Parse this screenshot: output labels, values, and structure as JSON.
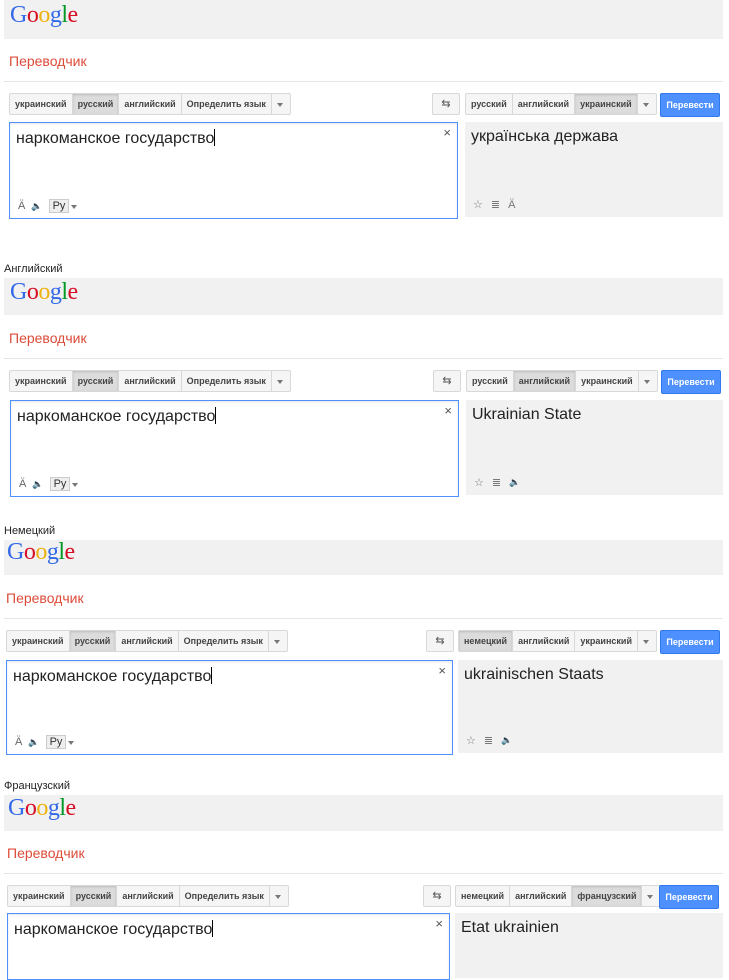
{
  "common": {
    "logo": [
      "G",
      "o",
      "o",
      "g",
      "l",
      "e"
    ],
    "title": "Переводчик",
    "source_langs": [
      "украинский",
      "русский",
      "английский",
      "Определить язык"
    ],
    "source_text": "наркоманское государство",
    "clear": "×",
    "swap": "⇆",
    "translate_button": "Перевести",
    "ru_label": "Ру",
    "transliterate_glyph": "Ä",
    "speaker_glyph": "🔈",
    "star_glyph": "☆",
    "list_glyph": "≣"
  },
  "sections": [
    {
      "label": "",
      "target_langs": [
        "русский",
        "английский",
        "украинский"
      ],
      "target_text": "українська держава"
    },
    {
      "label": "Английский",
      "target_langs": [
        "русский",
        "английский",
        "украинский"
      ],
      "target_text": "Ukrainian State"
    },
    {
      "label": "Немецкий",
      "target_langs": [
        "немецкий",
        "английский",
        "украинский"
      ],
      "target_text": "ukrainischen Staats"
    },
    {
      "label": "Французский",
      "target_langs": [
        "немецкий",
        "английский",
        "французский"
      ],
      "target_text": "Etat ukrainien"
    }
  ]
}
